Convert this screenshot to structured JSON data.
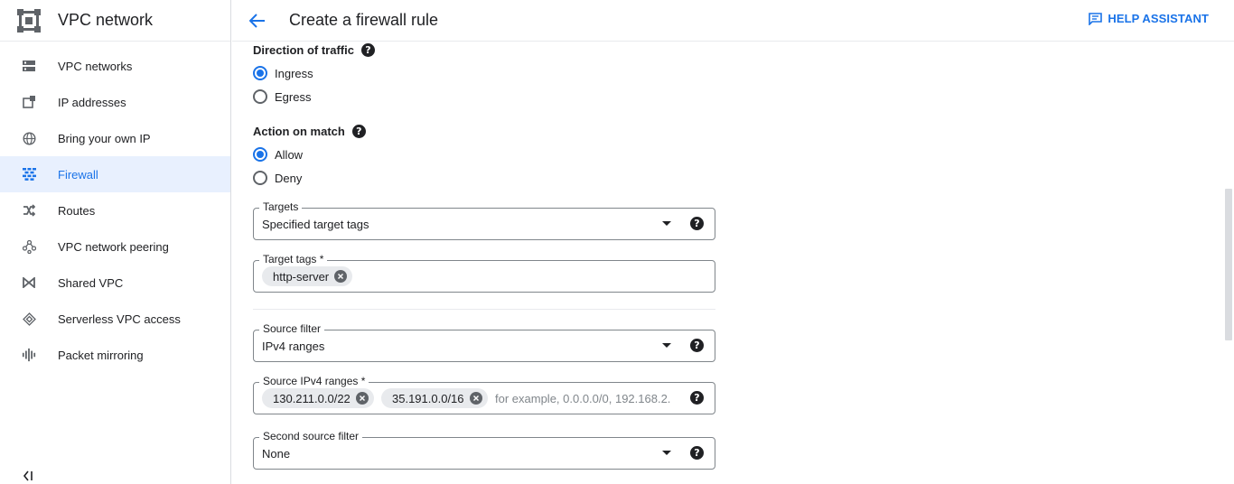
{
  "sidebar": {
    "title": "VPC network",
    "logo_icon": "vpc-network-logo",
    "items": [
      {
        "label": "VPC networks",
        "icon": "vpc-networks-icon",
        "active": false
      },
      {
        "label": "IP addresses",
        "icon": "ip-addresses-icon",
        "active": false
      },
      {
        "label": "Bring your own IP",
        "icon": "globe-icon",
        "active": false
      },
      {
        "label": "Firewall",
        "icon": "firewall-icon",
        "active": true
      },
      {
        "label": "Routes",
        "icon": "routes-icon",
        "active": false
      },
      {
        "label": "VPC network peering",
        "icon": "peering-icon",
        "active": false
      },
      {
        "label": "Shared VPC",
        "icon": "shared-vpc-icon",
        "active": false
      },
      {
        "label": "Serverless VPC access",
        "icon": "serverless-icon",
        "active": false
      },
      {
        "label": "Packet mirroring",
        "icon": "packet-mirroring-icon",
        "active": false
      }
    ],
    "collapse_icon": "collapse-sidebar-icon"
  },
  "header": {
    "title": "Create a firewall rule",
    "back_icon": "arrow-back-icon",
    "help_assistant_label": "HELP ASSISTANT"
  },
  "form": {
    "direction": {
      "label": "Direction of traffic",
      "options": [
        {
          "label": "Ingress",
          "checked": true
        },
        {
          "label": "Egress",
          "checked": false
        }
      ]
    },
    "action": {
      "label": "Action on match",
      "options": [
        {
          "label": "Allow",
          "checked": true
        },
        {
          "label": "Deny",
          "checked": false
        }
      ]
    },
    "targets": {
      "label": "Targets",
      "value": "Specified target tags"
    },
    "target_tags": {
      "label": "Target tags *",
      "chips": [
        "http-server"
      ]
    },
    "source_filter": {
      "label": "Source filter",
      "value": "IPv4 ranges"
    },
    "source_ipv4_ranges": {
      "label": "Source IPv4 ranges *",
      "chips": [
        "130.211.0.0/22",
        "35.191.0.0/16"
      ],
      "placeholder": "for example, 0.0.0.0/0, 192.168.2."
    },
    "second_source_filter": {
      "label": "Second source filter",
      "value": "None"
    }
  },
  "colors": {
    "accent": "#1a73e8",
    "active_bg": "#e8f0fe",
    "border": "#80868b",
    "chip_bg": "#e8eaed"
  }
}
